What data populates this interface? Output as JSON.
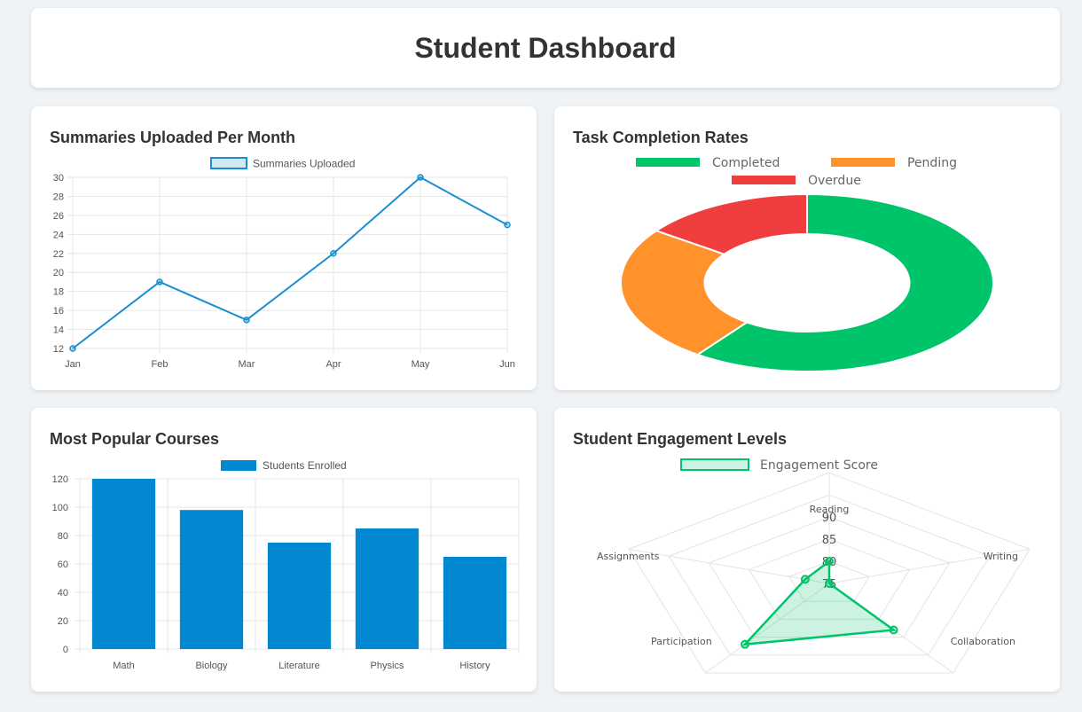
{
  "header": {
    "title": "Student Dashboard"
  },
  "panels": {
    "summaries": {
      "title": "Summaries Uploaded Per Month"
    },
    "tasks": {
      "title": "Task Completion Rates"
    },
    "courses": {
      "title": "Most Popular Courses"
    },
    "engagement": {
      "title": "Student Engagement Levels"
    }
  },
  "chart_data": [
    {
      "type": "line",
      "title": "Summaries Uploaded Per Month",
      "categories": [
        "Jan",
        "Feb",
        "Mar",
        "Apr",
        "May",
        "Jun"
      ],
      "series": [
        {
          "name": "Summaries Uploaded",
          "values": [
            12,
            19,
            15,
            22,
            30,
            25
          ]
        }
      ],
      "ylim": [
        12,
        30
      ],
      "yticks": [
        12,
        14,
        16,
        18,
        20,
        22,
        24,
        26,
        28,
        30
      ],
      "color": "#1a8fd1",
      "legend": "top",
      "grid": true
    },
    {
      "type": "pie",
      "variant": "doughnut",
      "title": "Task Completion Rates",
      "labels": [
        "Completed",
        "Pending",
        "Overdue"
      ],
      "values": [
        60,
        25,
        15
      ],
      "colors": [
        "#00c46a",
        "#ff922b",
        "#f03e3e"
      ],
      "legend": "top"
    },
    {
      "type": "bar",
      "title": "Most Popular Courses",
      "categories": [
        "Math",
        "Biology",
        "Literature",
        "Physics",
        "History"
      ],
      "series": [
        {
          "name": "Students Enrolled",
          "values": [
            120,
            98,
            75,
            85,
            65
          ]
        }
      ],
      "ylim": [
        0,
        120
      ],
      "yticks": [
        0,
        20,
        40,
        60,
        80,
        100,
        120
      ],
      "color": "#0288d1",
      "legend": "top",
      "grid": true
    },
    {
      "type": "radar",
      "title": "Student Engagement Levels",
      "axes": [
        "Reading",
        "Writing",
        "Collaboration",
        "Participation",
        "Assignments"
      ],
      "series": [
        {
          "name": "Engagement Score",
          "values": [
            80,
            75,
            88,
            92,
            78
          ]
        }
      ],
      "ticks": [
        75,
        80,
        85,
        90
      ],
      "color": "#00c46a",
      "legend": "top"
    }
  ]
}
